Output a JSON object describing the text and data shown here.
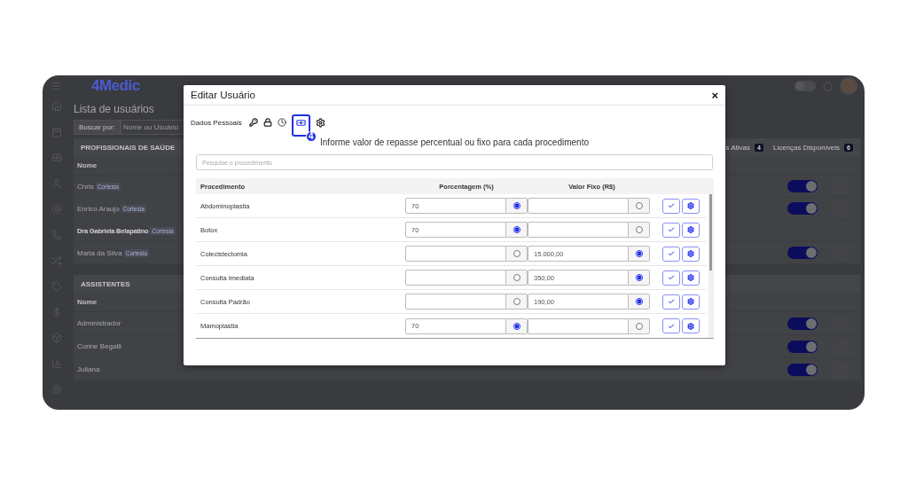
{
  "app": {
    "logo": "4Medic",
    "theme_switch": {
      "on": false
    },
    "page_title": "Lista de usuários",
    "search": {
      "label": "Buscar por:",
      "placeholder": "Nome ou Usuário"
    },
    "sections": [
      {
        "title": "PROFISSIONAIS DE SAÚDE",
        "counters": [
          {
            "label": "s Ativas",
            "count": "4"
          },
          {
            "label": "Licenças Disponíveis",
            "count": "6"
          }
        ],
        "column": "Nome",
        "rows": [
          {
            "name": "Chris",
            "tag": "Cortesia",
            "emphasized": false,
            "active": true
          },
          {
            "name": "Enrico Araujo",
            "tag": "Cortesia",
            "emphasized": false,
            "active": true
          },
          {
            "name": "Dra Gabriela Belapatino",
            "tag": "Cortesia",
            "emphasized": true
          },
          {
            "name": "Maria da Silva",
            "tag": "Cortesia",
            "emphasized": false,
            "active": true
          }
        ]
      },
      {
        "title": "ASSISTENTES",
        "column": "Nome",
        "rows": [
          {
            "name": "Administrador",
            "emphasized": false,
            "active": true
          },
          {
            "name": "Corine Begalli",
            "emphasized": false,
            "active": true
          },
          {
            "name": "Juliana",
            "emphasized": false,
            "active": true
          }
        ]
      }
    ]
  },
  "modal": {
    "title": "Editar Usuário",
    "close": "×",
    "tabs": [
      {
        "kind": "text",
        "label": "Dados Pessoais",
        "selected": false
      },
      {
        "kind": "key",
        "selected": false
      },
      {
        "kind": "lock",
        "selected": false
      },
      {
        "kind": "clock",
        "selected": false
      },
      {
        "kind": "money",
        "selected": true,
        "badge": "4"
      },
      {
        "kind": "gear",
        "selected": false
      }
    ],
    "heading": "Informe valor de repasse percentual ou fixo para cada procedimento",
    "search": {
      "placeholder": "Pesquise o procedimento"
    },
    "columns": [
      "Procedimento",
      "Porcentagem (%)",
      "Valor Fixo (R$)"
    ],
    "rows": [
      {
        "procedure": "Abdominoplastia",
        "percent": {
          "value": "70",
          "selected": true
        },
        "fixed": {
          "selected": false
        }
      },
      {
        "procedure": "Botox",
        "percent": {
          "value": "70",
          "selected": true
        },
        "fixed": {
          "selected": false
        }
      },
      {
        "procedure": "Colecistectomia",
        "percent": {
          "selected": false
        },
        "fixed": {
          "value": "15.000,00",
          "selected": true
        }
      },
      {
        "procedure": "Consulta Imediata",
        "percent": {
          "selected": false
        },
        "fixed": {
          "value": "350,00",
          "selected": true
        }
      },
      {
        "procedure": "Consulta Padrão",
        "percent": {
          "selected": false
        },
        "fixed": {
          "value": "190,00",
          "selected": true
        }
      },
      {
        "procedure": "Mamoplastia",
        "percent": {
          "value": "70",
          "selected": true
        },
        "fixed": {
          "selected": false
        }
      }
    ]
  }
}
